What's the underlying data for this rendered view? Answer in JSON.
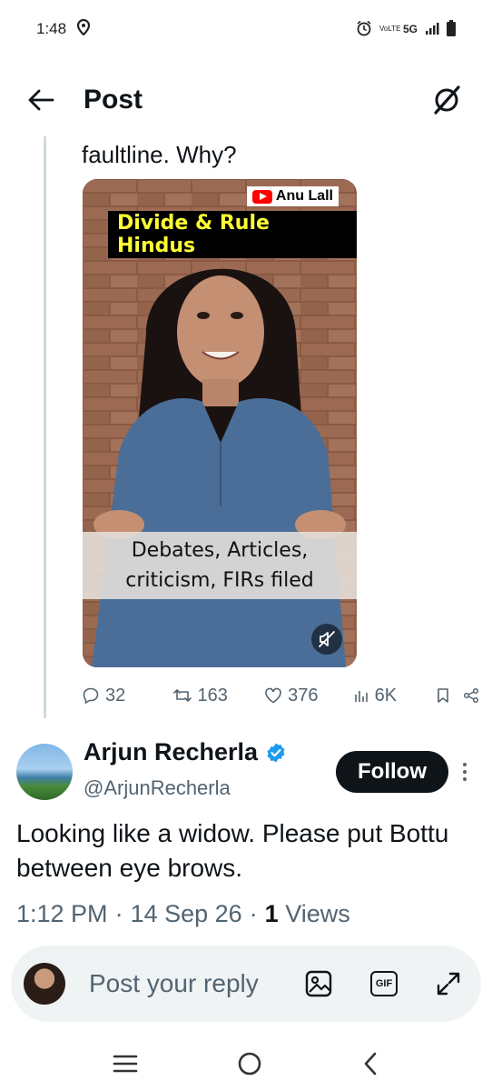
{
  "status_bar": {
    "time": "1:48",
    "network_label": "5G",
    "volte_label": "VoLTE"
  },
  "header": {
    "title": "Post"
  },
  "parent_tweet": {
    "text_tail": "faultline. Why?",
    "media": {
      "channel_badge": "Anu Lall",
      "headline": "Divide & Rule Hindus",
      "caption_line1": "Debates, Articles,",
      "caption_line2": "criticism, FIRs filed"
    },
    "stats": {
      "replies": "32",
      "reposts": "163",
      "likes": "376",
      "views": "6K"
    }
  },
  "reply": {
    "display_name": "Arjun Recherla",
    "handle": "@ArjunRecherla",
    "follow_label": "Follow",
    "text": "Looking like a widow. Please put Bottu between eye brows.",
    "time": "1:12 PM",
    "date": "14 Sep 26",
    "views_count": "1",
    "views_label": "Views"
  },
  "composer": {
    "placeholder": "Post your reply",
    "gif_label": "GIF"
  },
  "colors": {
    "text_primary": "#0f1419",
    "text_secondary": "#536471",
    "verified_blue": "#1d9bf0",
    "youtube_red": "#ff0000",
    "headline_yellow": "#ffff33"
  }
}
